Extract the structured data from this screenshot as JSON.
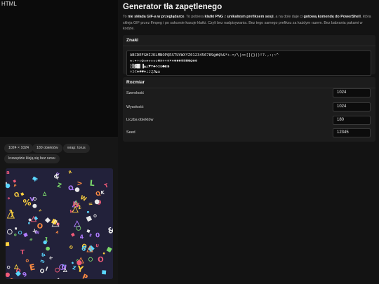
{
  "html_label": "HTML",
  "header": {
    "title": "Generator tła zapętlenego"
  },
  "description": {
    "p1": "To ",
    "p2": "nie składa GIF-a w przeglądarce",
    "p3": ". To pobiera ",
    "p4": "klatki PNG",
    "p5": " z ",
    "p6": "unikalnym prefiksem sesji",
    "p7": ", a na dole daje ci ",
    "p8": "gotową komendę do PowerShell",
    "p9": ", która skleja GIF przez ffmpeg i po sukcesie kasuje klatki. Czyli bez nadpisywania. Bez tego samego prefiksu za każdym razem. Bez babrania pakami w kodzie."
  },
  "znaki": {
    "title": "Znaki",
    "lines": [
      "ABCDEFGHIJKLMNOPQRSTUVWXYZ0123456789@#$%&*+-=/\\|<>[]{}()!?.,:;~^",
      "★☆✦✧✩✪✫✬✭✮✯✰✱✲✳✴✵✶✷✸✹✺✻✼✽✾✿❀❁",
      "░▒▓█▌▐▲△▼▽◆◇○◎●◐◑",
      "☼☽☾♠♣♥♦♩♪♫♬☯☮"
    ]
  },
  "rozmiar": {
    "title": "Rozmiar",
    "fields": [
      {
        "label": "Szerokość",
        "value": "1024"
      },
      {
        "label": "Wysokość",
        "value": "1024"
      },
      {
        "label": "Liczba obiektów",
        "value": "180"
      },
      {
        "label": "Seed",
        "value": "12345"
      }
    ]
  },
  "badges": {
    "size": "1024 × 1024",
    "objects": "180 obiektów",
    "wrap": "wrap: torus",
    "edges": "krawędzie kleją się bez szwu"
  },
  "preview": {
    "background": "#22213a",
    "corner_glyph": "a",
    "palette": [
      "#f05a78",
      "#5ad6ff",
      "#ffd23f",
      "#7bd86b",
      "#b07cff",
      "#ff8c42",
      "#e8e8e8"
    ]
  }
}
